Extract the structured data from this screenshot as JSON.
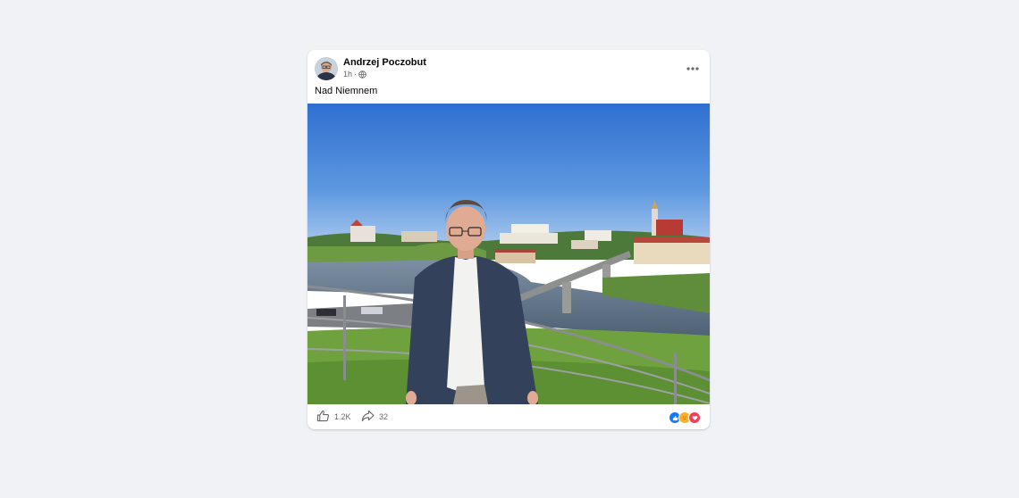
{
  "post": {
    "author": "Andrzej Poczobut",
    "time": "1h",
    "separator": "·",
    "caption": "Nad Niemnem"
  },
  "footer": {
    "likes": "1.2K",
    "shares": "32"
  },
  "icons": {
    "audience": "globe-icon",
    "menu": "more-options-icon",
    "like": "thumbs-up-icon",
    "share": "share-arrow-icon",
    "reactions": [
      "like-reaction-icon",
      "care-reaction-icon",
      "love-reaction-icon"
    ]
  },
  "colors": {
    "background": "#f0f2f5",
    "like_blue": "#1877f2",
    "love_red": "#f33e58",
    "care_yellow": "#f7b125",
    "secondary_text": "#65676b"
  }
}
